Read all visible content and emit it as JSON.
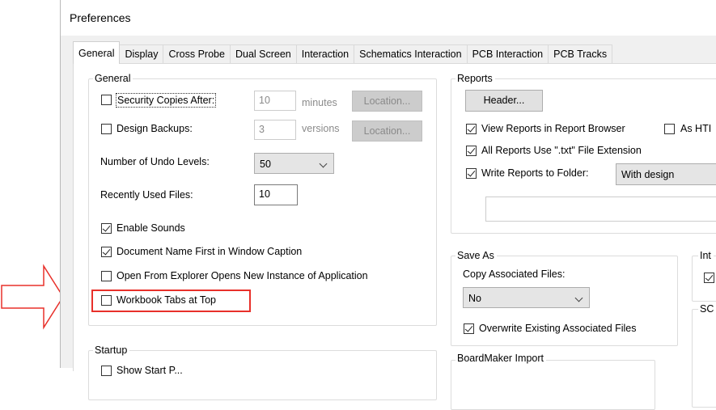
{
  "window": {
    "title": "Preferences"
  },
  "tabs": [
    {
      "label": "General",
      "active": true
    },
    {
      "label": "Display"
    },
    {
      "label": "Cross Probe"
    },
    {
      "label": "Dual Screen"
    },
    {
      "label": "Interaction"
    },
    {
      "label": "Schematics Interaction"
    },
    {
      "label": "PCB Interaction"
    },
    {
      "label": "PCB Tracks"
    }
  ],
  "general": {
    "legend": "General",
    "security_copies": {
      "label": "Security Copies After:",
      "checked": false,
      "value": "10",
      "unit": "minutes",
      "button": "Location..."
    },
    "design_backups": {
      "label": "Design Backups:",
      "checked": false,
      "value": "3",
      "unit": "versions",
      "button": "Location..."
    },
    "undo_levels": {
      "label": "Number of Undo Levels:",
      "value": "50"
    },
    "recent_files": {
      "label": "Recently Used Files:",
      "value": "10"
    },
    "enable_sounds": {
      "label": "Enable Sounds",
      "checked": true
    },
    "doc_name_first": {
      "label": "Document Name First in Window Caption",
      "checked": true
    },
    "open_new_instance": {
      "label": "Open From Explorer Opens New Instance of Application",
      "checked": false
    },
    "workbook_tabs_top": {
      "label": "Workbook Tabs at Top",
      "checked": false
    }
  },
  "startup": {
    "legend": "Startup",
    "first_item_label": "Show Start P..."
  },
  "reports": {
    "legend": "Reports",
    "header_button": "Header...",
    "view_in_browser": {
      "label": "View Reports in Report Browser",
      "checked": true
    },
    "as_html": {
      "label": "As HTI",
      "checked": false
    },
    "txt_extension": {
      "label": "All Reports Use \".txt\" File Extension",
      "checked": true
    },
    "write_to_folder": {
      "label": "Write Reports to Folder:",
      "checked": true,
      "value": "With design"
    },
    "folder_path": ""
  },
  "save_as": {
    "legend": "Save As",
    "copy_files_label": "Copy Associated Files:",
    "copy_files_value": "No",
    "overwrite": {
      "label": "Overwrite Existing Associated Files",
      "checked": true
    }
  },
  "boardmaker": {
    "legend": "BoardMaker Import"
  },
  "partial_groups": {
    "int_legend": "Int",
    "sc_legend": "SC"
  },
  "annotation": {
    "highlight_color": "#e8302a",
    "arrow_color": "#e8302a"
  }
}
